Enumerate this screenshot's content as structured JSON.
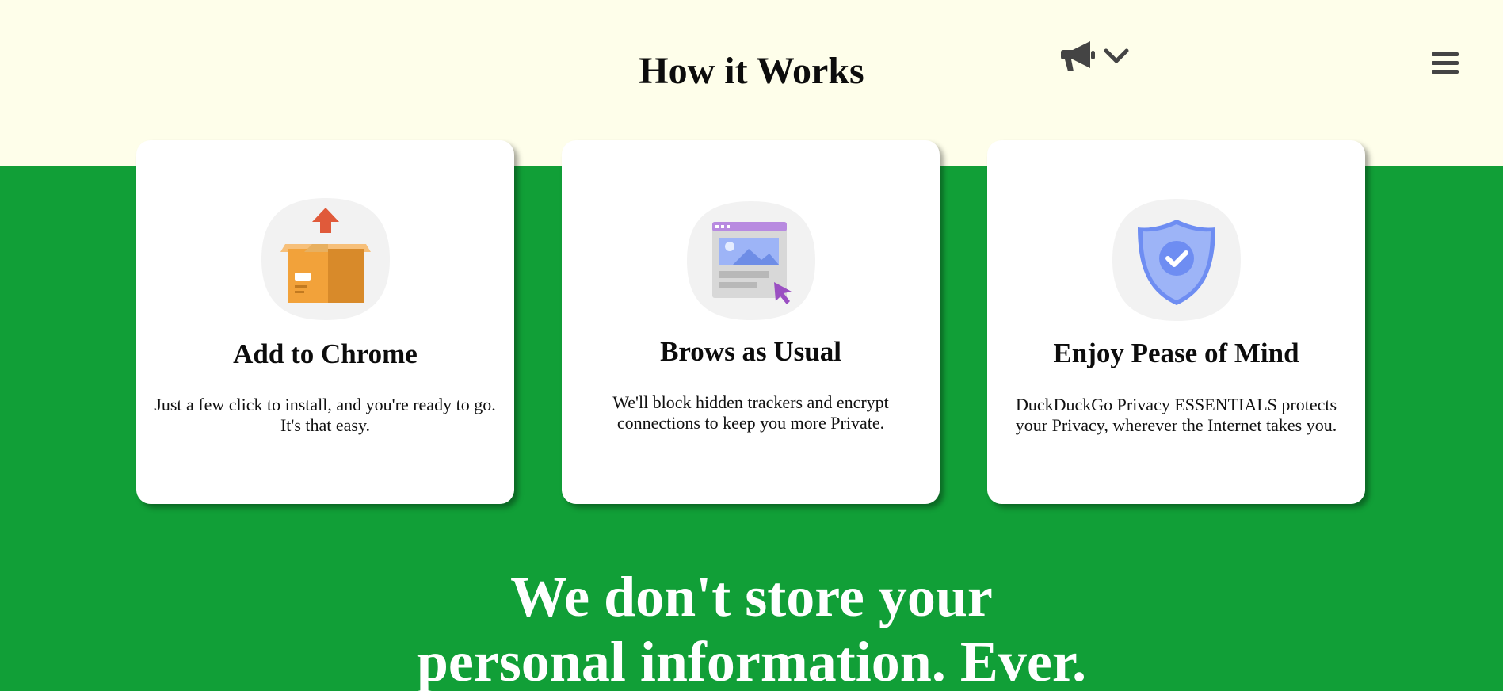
{
  "header": {
    "title": "How it Works",
    "announce_icon": "megaphone-icon",
    "dropdown_icon": "chevron-down-icon",
    "menu_icon": "hamburger-menu-icon"
  },
  "steps": [
    {
      "icon": "package-upload-icon",
      "title": "Add to Chrome",
      "text": "Just a few click to install, and you're ready to go. It's that easy."
    },
    {
      "icon": "browser-window-icon",
      "title": "Brows as Usual",
      "text": "We'll block hidden trackers and encrypt connections to keep you more Private."
    },
    {
      "icon": "shield-check-icon",
      "title": "Enjoy Pease of Mind",
      "text": "DuckDuckGo Privacy ESSENTIALS protects your Privacy, wherever the Internet takes you."
    }
  ],
  "tagline": {
    "line1": "We don't store your",
    "line2": "personal information. Ever."
  },
  "colors": {
    "top_band": "#fefeea",
    "green": "#119f37",
    "card": "#ffffff",
    "icon_dark": "#444444"
  }
}
